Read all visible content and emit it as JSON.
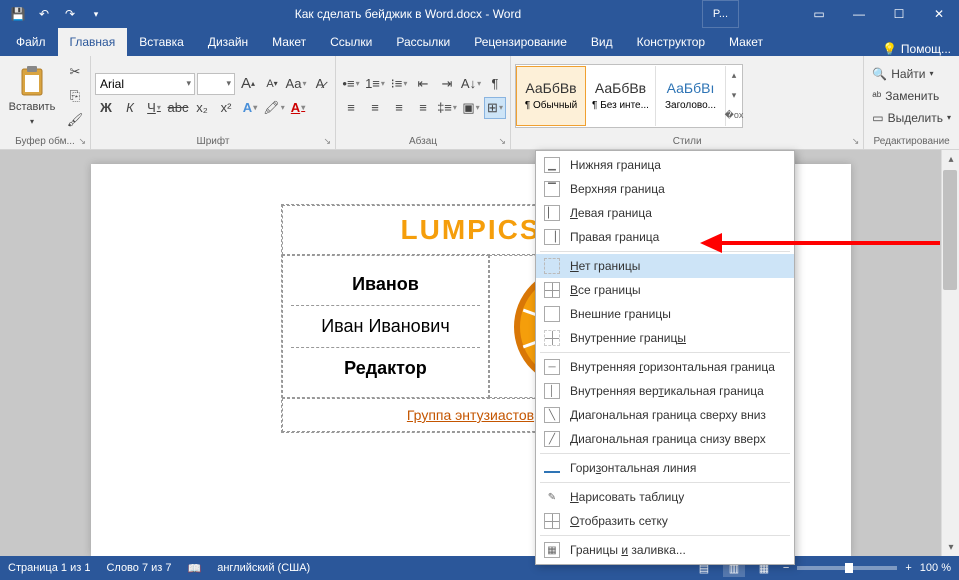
{
  "title": "Как сделать бейджик в Word.docx - Word",
  "user_label": "P...",
  "tabs": {
    "file": "Файл",
    "home": "Главная",
    "insert": "Вставка",
    "design": "Дизайн",
    "layout": "Макет",
    "references": "Ссылки",
    "mailings": "Рассылки",
    "review": "Рецензирование",
    "view": "Вид",
    "table_design": "Конструктор",
    "table_layout": "Макет",
    "tell_me": "Помощ..."
  },
  "ribbon": {
    "clipboard": {
      "paste": "Вставить",
      "label": "Буфер обм..."
    },
    "font": {
      "name": "Arial",
      "size": "",
      "label": "Шрифт",
      "bold": "Ж",
      "italic": "К",
      "underline": "Ч",
      "strike": "abc",
      "sub": "x₂",
      "sup": "x²",
      "grow": "A",
      "shrink": "A",
      "case": "Aa",
      "clear": "A"
    },
    "paragraph": {
      "label": "Абзац"
    },
    "styles": {
      "label": "Стили",
      "preview1": "АаБбВв",
      "name1": "¶ Обычный",
      "preview2": "АаБбВв",
      "name2": "¶ Без инте...",
      "preview3": "АаБбВı",
      "name3": "Заголово..."
    },
    "editing": {
      "label": "Редактирование",
      "find": "Найти",
      "replace": "Заменить",
      "select": "Выделить"
    }
  },
  "document": {
    "brand": "LUMPICS",
    "surname": "Иванов",
    "name": "Иван Иванович",
    "role": "Редактор",
    "link": "Группа энтузиастов"
  },
  "borders_menu": [
    "Нижняя граница",
    "Верхняя граница",
    "Левая граница",
    "Правая граница",
    "Нет границы",
    "Все границы",
    "Внешние границы",
    "Внутренние границы",
    "Внутренняя горизонтальная граница",
    "Внутренняя вертикальная граница",
    "Диагональная граница сверху вниз",
    "Диагональная граница снизу вверх",
    "Горизонтальная линия",
    "Нарисовать таблицу",
    "Отобразить сетку",
    "Границы и заливка..."
  ],
  "status": {
    "page": "Страница 1 из 1",
    "words": "Слово 7 из 7",
    "lang": "английский (США)",
    "zoom": "100 %"
  }
}
